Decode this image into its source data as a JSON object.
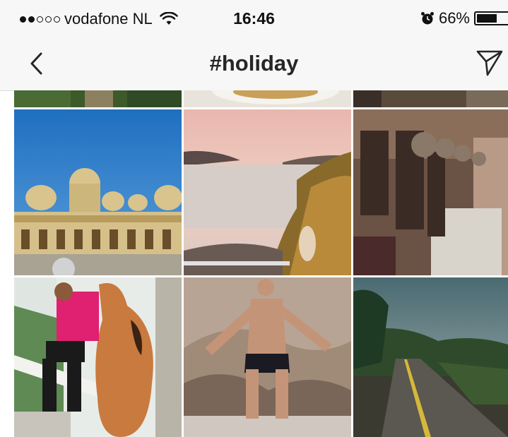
{
  "status_bar": {
    "signal_full": 2,
    "signal_total": 5,
    "carrier": "vodafone NL",
    "time": "16:46",
    "battery_percent": "66%",
    "battery_level": 0.66,
    "icons": [
      "wifi-icon",
      "alarm-clock-icon",
      "battery-icon"
    ]
  },
  "nav": {
    "title": "#holiday",
    "back_icon": "chevron-left-icon",
    "action_icon": "paper-plane-icon"
  },
  "grid": {
    "columns": 3,
    "photos": [
      {
        "name": "photo-partial-greenery"
      },
      {
        "name": "photo-partial-plate"
      },
      {
        "name": "photo-partial-dark"
      },
      {
        "name": "photo-mosque-domes"
      },
      {
        "name": "photo-coastal-bay-sunset"
      },
      {
        "name": "photo-vintage-projectors"
      },
      {
        "name": "photo-man-pink-shirt-vase"
      },
      {
        "name": "photo-man-sitting-rocks"
      },
      {
        "name": "photo-rural-road"
      }
    ]
  }
}
